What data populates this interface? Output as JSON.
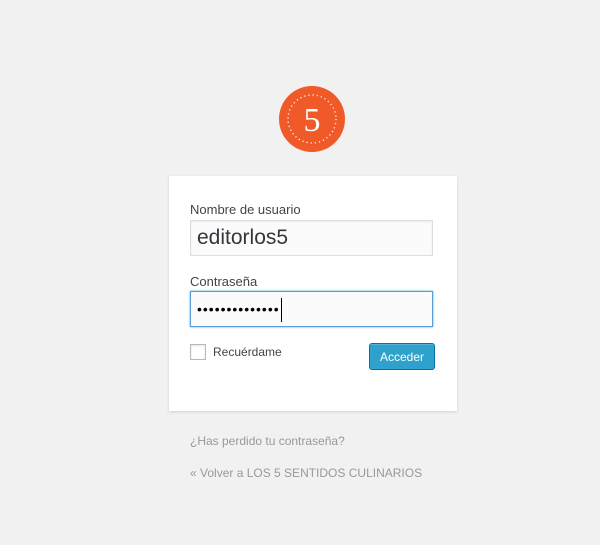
{
  "logo": {
    "text": "5",
    "color": "#f05a28"
  },
  "form": {
    "username_label": "Nombre de usuario",
    "username_value": "editorlos5",
    "password_label": "Contraseña",
    "password_masked": "••••••••••••••",
    "remember_label": "Recuérdame",
    "remember_checked": false,
    "submit_label": "Acceder"
  },
  "links": {
    "lost_password": "¿Has perdido tu contraseña?",
    "back_to_site": "« Volver a LOS 5 SENTIDOS CULINARIOS"
  },
  "colors": {
    "background": "#f1f1f1",
    "button": "#2ea2cc",
    "focus_border": "#5b9dd9",
    "link": "#999999"
  }
}
